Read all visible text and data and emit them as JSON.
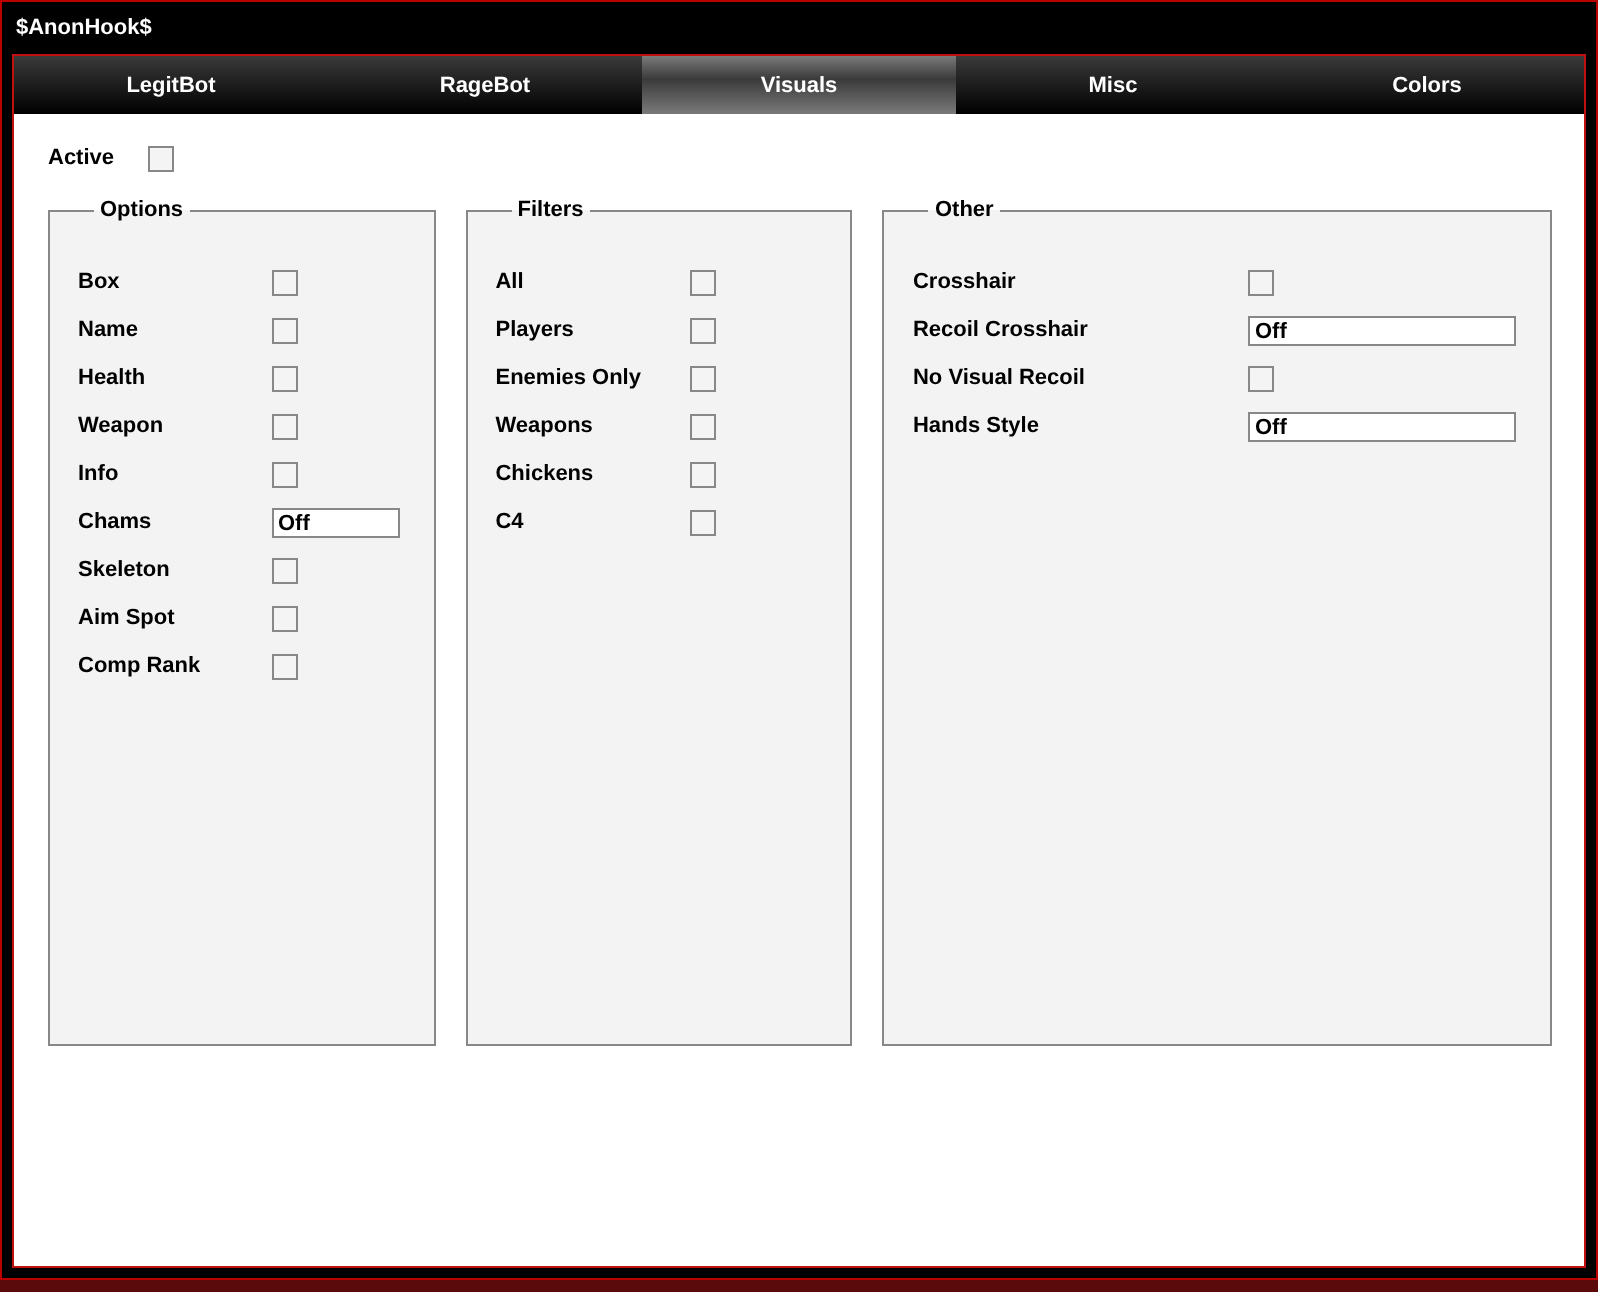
{
  "window": {
    "title": "$AnonHook$"
  },
  "tabs": [
    {
      "label": "LegitBot",
      "selected": false
    },
    {
      "label": "RageBot",
      "selected": false
    },
    {
      "label": "Visuals",
      "selected": true
    },
    {
      "label": "Misc",
      "selected": false
    },
    {
      "label": "Colors",
      "selected": false
    }
  ],
  "active": {
    "label": "Active",
    "checked": false
  },
  "groups": [
    {
      "title": "Options",
      "items": [
        {
          "kind": "checkbox",
          "label": "Box",
          "checked": false
        },
        {
          "kind": "checkbox",
          "label": "Name",
          "checked": false
        },
        {
          "kind": "checkbox",
          "label": "Health",
          "checked": false
        },
        {
          "kind": "checkbox",
          "label": "Weapon",
          "checked": false
        },
        {
          "kind": "checkbox",
          "label": "Info",
          "checked": false
        },
        {
          "kind": "dropdown",
          "label": "Chams",
          "value": "Off"
        },
        {
          "kind": "checkbox",
          "label": "Skeleton",
          "checked": false
        },
        {
          "kind": "checkbox",
          "label": "Aim Spot",
          "checked": false
        },
        {
          "kind": "checkbox",
          "label": "Comp Rank",
          "checked": false
        }
      ]
    },
    {
      "title": "Filters",
      "items": [
        {
          "kind": "checkbox",
          "label": "All",
          "checked": false
        },
        {
          "kind": "checkbox",
          "label": "Players",
          "checked": false
        },
        {
          "kind": "checkbox",
          "label": "Enemies Only",
          "checked": false
        },
        {
          "kind": "checkbox",
          "label": "Weapons",
          "checked": false
        },
        {
          "kind": "checkbox",
          "label": "Chickens",
          "checked": false
        },
        {
          "kind": "checkbox",
          "label": "C4",
          "checked": false
        }
      ]
    },
    {
      "title": "Other",
      "items": [
        {
          "kind": "checkbox",
          "label": "Crosshair",
          "checked": false
        },
        {
          "kind": "dropdown",
          "label": "Recoil Crosshair",
          "value": "Off"
        },
        {
          "kind": "checkbox",
          "label": "No Visual Recoil",
          "checked": false
        },
        {
          "kind": "dropdown",
          "label": "Hands Style",
          "value": "Off"
        }
      ]
    }
  ]
}
